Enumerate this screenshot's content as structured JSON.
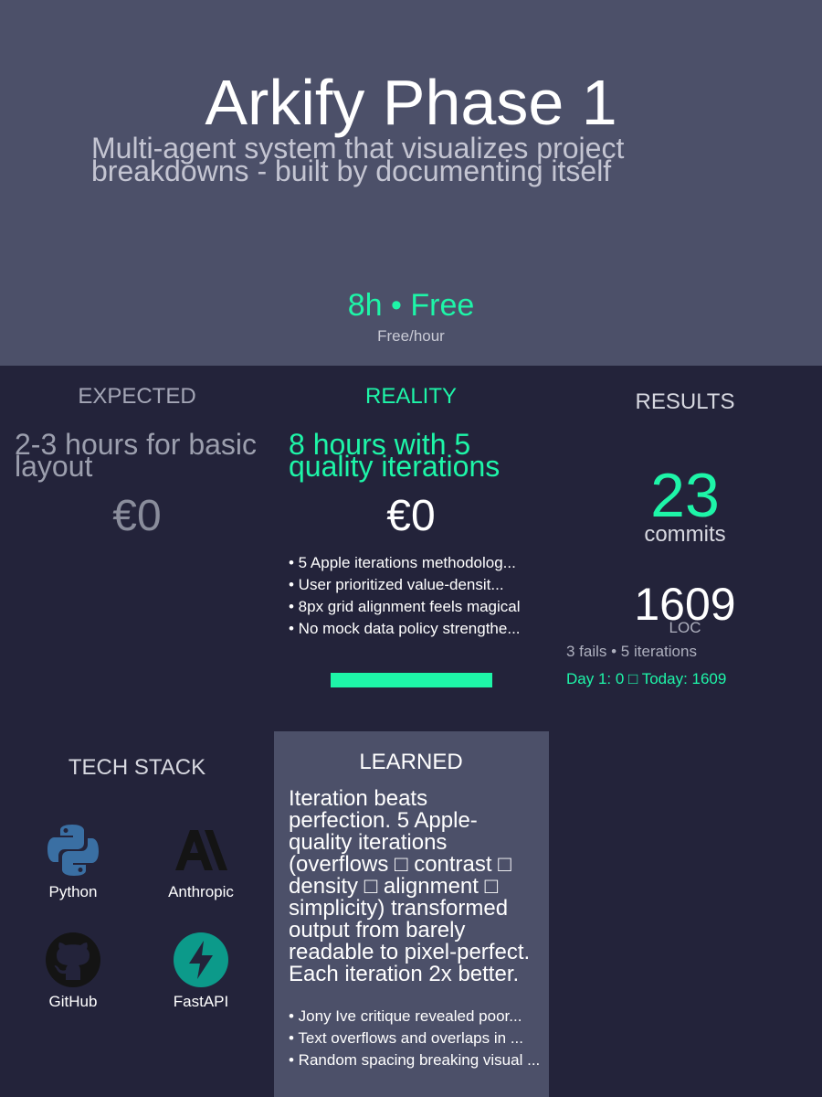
{
  "hero": {
    "title": "Arkify Phase 1",
    "subtitle": "Multi-agent system that visualizes project breakdowns - built by documenting itself",
    "duration": "8h • Free",
    "rate": "Free/hour"
  },
  "expected": {
    "heading": "EXPECTED",
    "text": "2-3 hours for basic layout",
    "cost": "€0"
  },
  "reality": {
    "heading": "REALITY",
    "text": "8 hours with 5 quality iterations",
    "cost": "€0",
    "points": [
      "• 5 Apple iterations methodolog...",
      "• User prioritized value-densit...",
      "• 8px grid alignment feels magical",
      "• No mock data policy strengthe..."
    ],
    "progress_fraction": 1.0
  },
  "results": {
    "heading": "RESULTS",
    "commits": "23",
    "commits_label": "commits",
    "loc": "1609",
    "loc_label": "LOC",
    "fails_iterations": "3 fails • 5 iterations",
    "growth": "Day 1: 0 □ Today: 1609"
  },
  "tech_stack": {
    "heading": "TECH STACK",
    "items": [
      {
        "name": "Python",
        "icon": "python-icon"
      },
      {
        "name": "Anthropic",
        "icon": "anthropic-icon"
      },
      {
        "name": "GitHub",
        "icon": "github-icon"
      },
      {
        "name": "FastAPI",
        "icon": "fastapi-icon"
      }
    ]
  },
  "learned": {
    "heading": "LEARNED",
    "text": "Iteration beats perfection. 5 Apple-quality iterations (overflows □ contrast □ density □ alignment □ simplicity) transformed output from barely readable to pixel-perfect. Each iteration 2x better.",
    "points": [
      "• Jony Ive critique revealed poor...",
      "• Text overflows and overlaps in ...",
      "• Random spacing breaking visual ..."
    ]
  },
  "colors": {
    "hero_bg": "#4c5069",
    "page_bg": "#23233a",
    "accent": "#1ef5a8"
  }
}
